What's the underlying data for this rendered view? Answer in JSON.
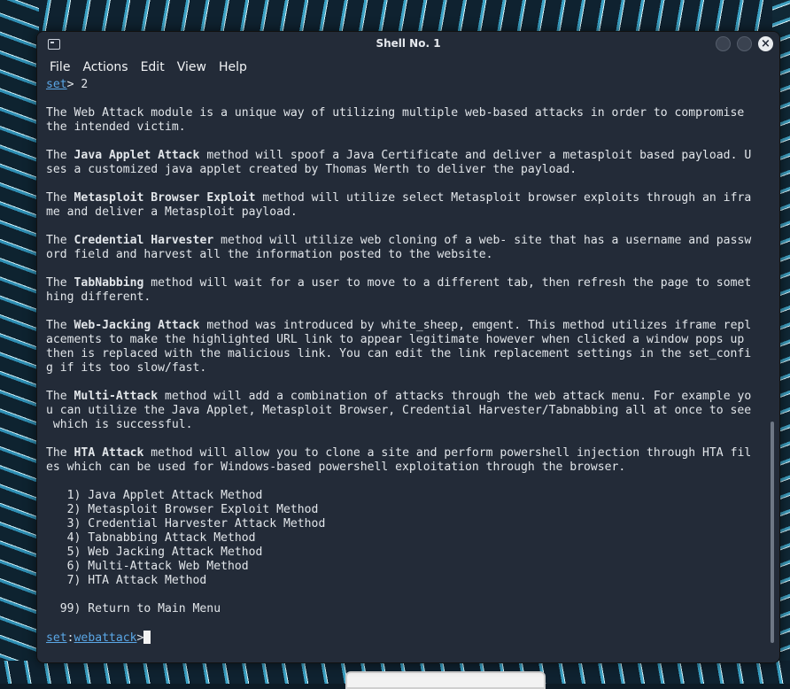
{
  "window": {
    "title": "Shell No. 1"
  },
  "menu": [
    "File",
    "Actions",
    "Edit",
    "View",
    "Help"
  ],
  "terminal": {
    "lines": [
      [
        {
          "t": "set",
          "s": "link"
        },
        {
          "t": "> 2"
        }
      ],
      [],
      [
        {
          "t": "The Web Attack module is a unique way of utilizing multiple web-based attacks in order to compromise"
        }
      ],
      [
        {
          "t": "the intended victim."
        }
      ],
      [],
      [
        {
          "t": "The "
        },
        {
          "t": "Java Applet Attack",
          "s": "b"
        },
        {
          "t": " method will spoof a Java Certificate and deliver a metasploit based payload. U"
        }
      ],
      [
        {
          "t": "ses a customized java applet created by Thomas Werth to deliver the payload."
        }
      ],
      [],
      [
        {
          "t": "The "
        },
        {
          "t": "Metasploit Browser Exploit",
          "s": "b"
        },
        {
          "t": " method will utilize select Metasploit browser exploits through an ifra"
        }
      ],
      [
        {
          "t": "me and deliver a Metasploit payload."
        }
      ],
      [],
      [
        {
          "t": "The "
        },
        {
          "t": "Credential Harvester",
          "s": "b"
        },
        {
          "t": " method will utilize web cloning of a web- site that has a username and passw"
        }
      ],
      [
        {
          "t": "ord field and harvest all the information posted to the website."
        }
      ],
      [],
      [
        {
          "t": "The "
        },
        {
          "t": "TabNabbing",
          "s": "b"
        },
        {
          "t": " method will wait for a user to move to a different tab, then refresh the page to somet"
        }
      ],
      [
        {
          "t": "hing different."
        }
      ],
      [],
      [
        {
          "t": "The "
        },
        {
          "t": "Web-Jacking Attack",
          "s": "b"
        },
        {
          "t": " method was introduced by white_sheep, emgent. This method utilizes iframe repl"
        }
      ],
      [
        {
          "t": "acements to make the highlighted URL link to appear legitimate however when clicked a window pops up"
        }
      ],
      [
        {
          "t": "then is replaced with the malicious link. You can edit the link replacement settings in the set_confi"
        }
      ],
      [
        {
          "t": "g if its too slow/fast."
        }
      ],
      [],
      [
        {
          "t": "The "
        },
        {
          "t": "Multi-Attack",
          "s": "b"
        },
        {
          "t": " method will add a combination of attacks through the web attack menu. For example yo"
        }
      ],
      [
        {
          "t": "u can utilize the Java Applet, Metasploit Browser, Credential Harvester/Tabnabbing all at once to see"
        }
      ],
      [
        {
          "t": " which is successful."
        }
      ],
      [],
      [
        {
          "t": "The "
        },
        {
          "t": "HTA Attack",
          "s": "b"
        },
        {
          "t": " method will allow you to clone a site and perform powershell injection through HTA fil"
        }
      ],
      [
        {
          "t": "es which can be used for Windows-based powershell exploitation through the browser."
        }
      ],
      [],
      [
        {
          "t": "   1) Java Applet Attack Method"
        }
      ],
      [
        {
          "t": "   2) Metasploit Browser Exploit Method"
        }
      ],
      [
        {
          "t": "   3) Credential Harvester Attack Method"
        }
      ],
      [
        {
          "t": "   4) Tabnabbing Attack Method"
        }
      ],
      [
        {
          "t": "   5) Web Jacking Attack Method"
        }
      ],
      [
        {
          "t": "   6) Multi-Attack Web Method"
        }
      ],
      [
        {
          "t": "   7) HTA Attack Method"
        }
      ],
      [],
      [
        {
          "t": "  99) Return to Main Menu"
        }
      ],
      [],
      [
        {
          "t": "set",
          "s": "link"
        },
        {
          "t": ":"
        },
        {
          "t": "webattack",
          "s": "link"
        },
        {
          "t": ">"
        },
        {
          "t": "",
          "s": "cursor"
        }
      ]
    ]
  }
}
